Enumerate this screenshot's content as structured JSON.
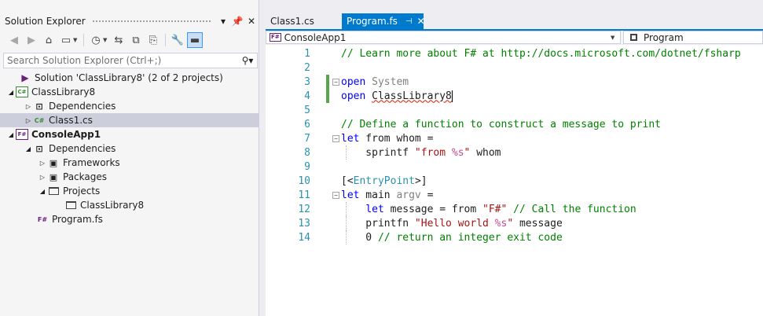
{
  "solution_explorer": {
    "title": "Solution Explorer",
    "pin_glyph": "↕",
    "search_placeholder": "Search Solution Explorer (Ctrl+;)",
    "tree": [
      {
        "label": "Solution 'ClassLibrary8' (2 of 2 projects)",
        "icon": "solution-icon",
        "glyph": "▶",
        "level": 0,
        "arrow": "",
        "bold": false,
        "selected": false
      },
      {
        "label": "ClassLibrary8",
        "icon": "csharp-project-icon",
        "glyph": "C#",
        "level": 0,
        "arrow": "◢",
        "bold": false,
        "selected": false
      },
      {
        "label": "Dependencies",
        "icon": "dependencies-icon",
        "glyph": "⊡",
        "level": 1,
        "arrow": "▷",
        "bold": false,
        "selected": false
      },
      {
        "label": "Class1.cs",
        "icon": "csharp-file-icon",
        "glyph": "C#",
        "level": 1,
        "arrow": "▷",
        "bold": false,
        "selected": true
      },
      {
        "label": "ConsoleApp1",
        "icon": "fsharp-project-icon",
        "glyph": "F#",
        "level": 0,
        "arrow": "◢",
        "bold": true,
        "selected": false
      },
      {
        "label": "Dependencies",
        "icon": "dependencies-icon",
        "glyph": "⊡",
        "level": 1,
        "arrow": "◢",
        "bold": false,
        "selected": false
      },
      {
        "label": "Frameworks",
        "icon": "frameworks-icon",
        "glyph": "▣",
        "level": 2,
        "arrow": "▷",
        "bold": false,
        "selected": false
      },
      {
        "label": "Packages",
        "icon": "packages-icon",
        "glyph": "▣",
        "level": 2,
        "arrow": "▷",
        "bold": false,
        "selected": false
      },
      {
        "label": "Projects",
        "icon": "projects-folder-icon",
        "glyph": "",
        "level": 2,
        "arrow": "◢",
        "bold": false,
        "selected": false
      },
      {
        "label": "ClassLibrary8",
        "icon": "project-reference-icon",
        "glyph": "",
        "level": 3,
        "arrow": "",
        "bold": false,
        "selected": false
      },
      {
        "label": "Program.fs",
        "icon": "fsharp-file-icon",
        "glyph": "F#",
        "level": 1,
        "arrow": "",
        "bold": false,
        "selected": false
      }
    ]
  },
  "tabs": [
    {
      "label": "Class1.cs",
      "active": false
    },
    {
      "label": "Program.fs",
      "active": true
    }
  ],
  "navbar": {
    "project": "ConsoleApp1",
    "project_icon_text": "F#",
    "member": "Program"
  },
  "editor": {
    "lines": [
      {
        "n": "1",
        "tokens": [
          {
            "t": "// Learn more about F# at http://docs.microsoft.com/dotnet/fsharp",
            "c": "cm"
          }
        ]
      },
      {
        "n": "2",
        "tokens": []
      },
      {
        "n": "3",
        "fold": "−",
        "tokens": [
          {
            "t": "open",
            "c": "kw"
          },
          {
            "t": " "
          },
          {
            "t": "System",
            "c": "gr"
          }
        ]
      },
      {
        "n": "4",
        "tokens": [
          {
            "t": "open",
            "c": "kw"
          },
          {
            "t": " "
          },
          {
            "t": "ClassLibrary8",
            "c": "squig"
          }
        ]
      },
      {
        "n": "5",
        "tokens": []
      },
      {
        "n": "6",
        "tokens": [
          {
            "t": "// Define a function to construct a message to print",
            "c": "cm"
          }
        ]
      },
      {
        "n": "7",
        "fold": "−",
        "tokens": [
          {
            "t": "let",
            "c": "kw"
          },
          {
            "t": " from whom ="
          }
        ]
      },
      {
        "n": "8",
        "tokens": [
          {
            "t": "    sprintf "
          },
          {
            "t": "\"from ",
            "c": "st"
          },
          {
            "t": "%s",
            "c": "fmt"
          },
          {
            "t": "\"",
            "c": "st"
          },
          {
            "t": " whom"
          }
        ]
      },
      {
        "n": "9",
        "tokens": []
      },
      {
        "n": "10",
        "tokens": [
          {
            "t": "[<"
          },
          {
            "t": "EntryPoint",
            "c": "ty"
          },
          {
            "t": ">]"
          }
        ]
      },
      {
        "n": "11",
        "fold": "−",
        "tokens": [
          {
            "t": "let",
            "c": "kw"
          },
          {
            "t": " main "
          },
          {
            "t": "argv",
            "c": "gr"
          },
          {
            "t": " ="
          }
        ]
      },
      {
        "n": "12",
        "tokens": [
          {
            "t": "    "
          },
          {
            "t": "let",
            "c": "kw"
          },
          {
            "t": " message = from "
          },
          {
            "t": "\"F#\"",
            "c": "st"
          },
          {
            "t": " "
          },
          {
            "t": "// Call the function",
            "c": "cm"
          }
        ]
      },
      {
        "n": "13",
        "tokens": [
          {
            "t": "    printfn "
          },
          {
            "t": "\"Hello world ",
            "c": "st"
          },
          {
            "t": "%s",
            "c": "fmt"
          },
          {
            "t": "\"",
            "c": "st"
          },
          {
            "t": " message"
          }
        ]
      },
      {
        "n": "14",
        "tokens": [
          {
            "t": "    0 "
          },
          {
            "t": "// return an integer exit code",
            "c": "cm"
          }
        ]
      }
    ]
  },
  "colors": {
    "accent": "#007acc",
    "keyword": "#0000ff",
    "comment": "#008000",
    "string": "#a31515",
    "line_number": "#2b91af",
    "change_bar": "#57a64a"
  }
}
